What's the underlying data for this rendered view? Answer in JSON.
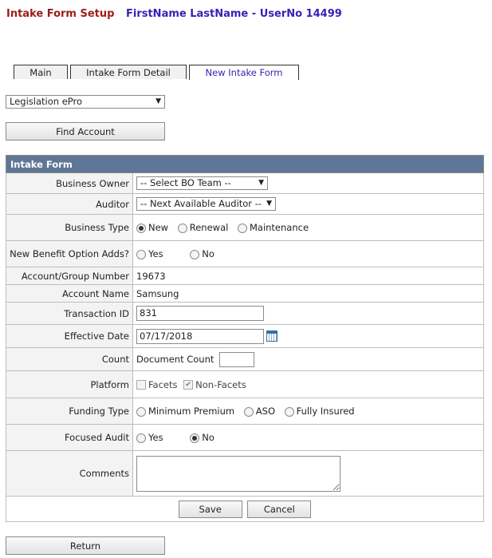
{
  "header": {
    "title": "Intake Form Setup",
    "user": "FirstName LastName - UserNo 14499"
  },
  "tabs": [
    {
      "label": "Main"
    },
    {
      "label": "Intake Form Detail"
    },
    {
      "label": "New Intake Form"
    }
  ],
  "top_select": {
    "value": "Legislation ePro"
  },
  "find_account_label": "Find Account",
  "form": {
    "heading": "Intake Form",
    "business_owner": {
      "label": "Business Owner",
      "value": "-- Select BO Team --"
    },
    "auditor": {
      "label": "Auditor",
      "value": "-- Next Available Auditor --"
    },
    "business_type": {
      "label": "Business Type",
      "options": [
        "New",
        "Renewal",
        "Maintenance"
      ]
    },
    "benefit_adds": {
      "label": "New Benefit Option Adds?",
      "options": [
        "Yes",
        "No"
      ]
    },
    "account_group": {
      "label": "Account/Group Number",
      "value": "19673"
    },
    "account_name": {
      "label": "Account Name",
      "value": "Samsung"
    },
    "transaction_id": {
      "label": "Transaction ID",
      "value": "831"
    },
    "effective_date": {
      "label": "Effective Date",
      "value": "07/17/2018"
    },
    "count": {
      "label": "Count",
      "doc_label": "Document Count",
      "value": ""
    },
    "platform": {
      "label": "Platform",
      "options": [
        "Facets",
        "Non-Facets"
      ]
    },
    "funding_type": {
      "label": "Funding Type",
      "options": [
        "Minimum Premium",
        "ASO",
        "Fully Insured"
      ]
    },
    "focused_audit": {
      "label": "Focused Audit",
      "options": [
        "Yes",
        "No"
      ]
    },
    "comments": {
      "label": "Comments",
      "value": ""
    }
  },
  "buttons": {
    "save": "Save",
    "cancel": "Cancel",
    "return": "Return"
  }
}
